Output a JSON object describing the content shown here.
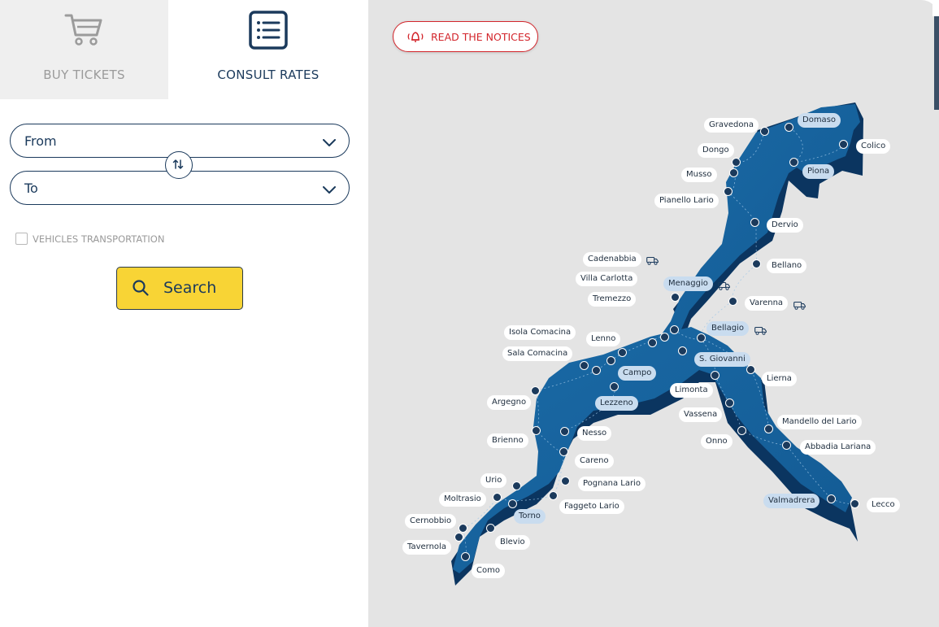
{
  "tabs": {
    "buy": {
      "label": "BUY TICKETS",
      "icon": "cart-icon"
    },
    "rates": {
      "label": "CONSULT RATES",
      "icon": "list-icon"
    }
  },
  "form": {
    "from_value": "From",
    "to_value": "To",
    "vehicles_label": "VEHICLES TRANSPORTATION",
    "vehicles_checked": false,
    "search_label": "Search"
  },
  "notice": {
    "label": "READ THE NOTICES"
  },
  "colors": {
    "navy": "#1b3a5c",
    "lake_dark": "#0d3b66",
    "lake_mid": "#15609a",
    "search_yellow": "#f8d435",
    "notice_red": "#d3262c",
    "map_bg": "#e4e4e4"
  },
  "map": {
    "stops": [
      {
        "id": "gravedona",
        "label": "Gravedona",
        "highlight": false,
        "vehicle": false
      },
      {
        "id": "domaso",
        "label": "Domaso",
        "highlight": true,
        "vehicle": false
      },
      {
        "id": "dongo",
        "label": "Dongo",
        "highlight": false,
        "vehicle": false
      },
      {
        "id": "colico",
        "label": "Colico",
        "highlight": false,
        "vehicle": false
      },
      {
        "id": "musso",
        "label": "Musso",
        "highlight": false,
        "vehicle": false
      },
      {
        "id": "piona",
        "label": "Piona",
        "highlight": true,
        "vehicle": false
      },
      {
        "id": "pianello",
        "label": "Pianello Lario",
        "highlight": false,
        "vehicle": false
      },
      {
        "id": "dervio",
        "label": "Dervio",
        "highlight": false,
        "vehicle": false
      },
      {
        "id": "cadenabbia",
        "label": "Cadenabbia",
        "highlight": false,
        "vehicle": true
      },
      {
        "id": "bellano",
        "label": "Bellano",
        "highlight": false,
        "vehicle": false
      },
      {
        "id": "villacarlotta",
        "label": "Villa Carlotta",
        "highlight": false,
        "vehicle": false
      },
      {
        "id": "menaggio",
        "label": "Menaggio",
        "highlight": true,
        "vehicle": true
      },
      {
        "id": "tremezzo",
        "label": "Tremezzo",
        "highlight": false,
        "vehicle": false
      },
      {
        "id": "varenna",
        "label": "Varenna",
        "highlight": false,
        "vehicle": true
      },
      {
        "id": "bellagio",
        "label": "Bellagio",
        "highlight": true,
        "vehicle": true
      },
      {
        "id": "isola",
        "label": "Isola Comacina",
        "highlight": false,
        "vehicle": false
      },
      {
        "id": "lenno",
        "label": "Lenno",
        "highlight": false,
        "vehicle": false
      },
      {
        "id": "sala",
        "label": "Sala Comacina",
        "highlight": false,
        "vehicle": false
      },
      {
        "id": "sgiovanni",
        "label": "S. Giovanni",
        "highlight": true,
        "vehicle": false
      },
      {
        "id": "campo",
        "label": "Campo",
        "highlight": true,
        "vehicle": false
      },
      {
        "id": "lierna",
        "label": "Lierna",
        "highlight": false,
        "vehicle": false
      },
      {
        "id": "limonta",
        "label": "Limonta",
        "highlight": false,
        "vehicle": false
      },
      {
        "id": "argegno",
        "label": "Argegno",
        "highlight": false,
        "vehicle": false
      },
      {
        "id": "lezzeno",
        "label": "Lezzeno",
        "highlight": true,
        "vehicle": false
      },
      {
        "id": "vassena",
        "label": "Vassena",
        "highlight": false,
        "vehicle": false
      },
      {
        "id": "mandello",
        "label": "Mandello del Lario",
        "highlight": false,
        "vehicle": false
      },
      {
        "id": "nesso",
        "label": "Nesso",
        "highlight": false,
        "vehicle": false
      },
      {
        "id": "brienno",
        "label": "Brienno",
        "highlight": false,
        "vehicle": false
      },
      {
        "id": "onno",
        "label": "Onno",
        "highlight": false,
        "vehicle": false
      },
      {
        "id": "abbadia",
        "label": "Abbadia Lariana",
        "highlight": false,
        "vehicle": false
      },
      {
        "id": "careno",
        "label": "Careno",
        "highlight": false,
        "vehicle": false
      },
      {
        "id": "urio",
        "label": "Urio",
        "highlight": false,
        "vehicle": false
      },
      {
        "id": "pognana",
        "label": "Pognana Lario",
        "highlight": false,
        "vehicle": false
      },
      {
        "id": "moltrasio",
        "label": "Moltrasio",
        "highlight": false,
        "vehicle": false
      },
      {
        "id": "faggeto",
        "label": "Faggeto Lario",
        "highlight": false,
        "vehicle": false
      },
      {
        "id": "valmadrera",
        "label": "Valmadrera",
        "highlight": true,
        "vehicle": false
      },
      {
        "id": "lecco",
        "label": "Lecco",
        "highlight": false,
        "vehicle": false
      },
      {
        "id": "torno",
        "label": "Torno",
        "highlight": true,
        "vehicle": false
      },
      {
        "id": "cernobbio",
        "label": "Cernobbio",
        "highlight": false,
        "vehicle": false
      },
      {
        "id": "blevio",
        "label": "Blevio",
        "highlight": false,
        "vehicle": false
      },
      {
        "id": "tavernola",
        "label": "Tavernola",
        "highlight": false,
        "vehicle": false
      },
      {
        "id": "como",
        "label": "Como",
        "highlight": false,
        "vehicle": false
      }
    ]
  }
}
